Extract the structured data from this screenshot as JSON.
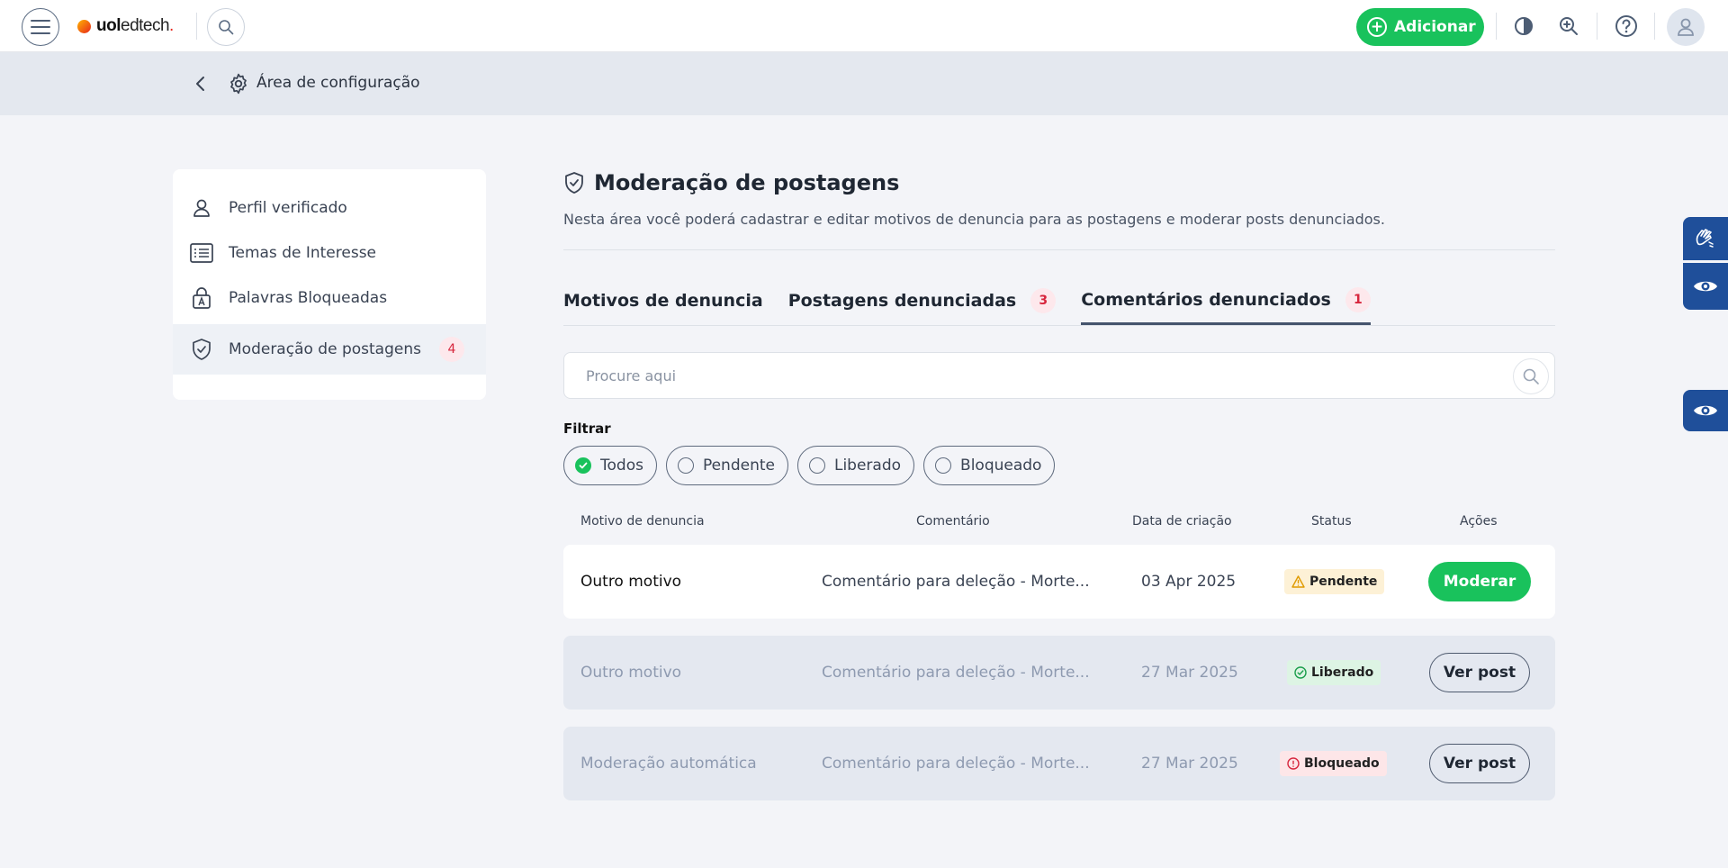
{
  "header": {
    "logo": {
      "bold": "uol",
      "thin": "edtech",
      "dot": "."
    },
    "add_label": "Adicionar",
    "icons": [
      "menu-icon",
      "search-icon",
      "contrast-icon",
      "zoom-in-icon",
      "help-icon",
      "user-icon"
    ]
  },
  "breadcrumb": {
    "label": "Área de configuração"
  },
  "sidebar": {
    "items": [
      {
        "label": "Perfil verificado",
        "icon": "user-icon"
      },
      {
        "label": "Temas de Interesse",
        "icon": "list-icon"
      },
      {
        "label": "Palavras Bloqueadas",
        "icon": "lock-icon"
      },
      {
        "label": "Moderação de postagens",
        "icon": "shield-check-icon",
        "count": "4"
      }
    ]
  },
  "main": {
    "title": "Moderação de postagens",
    "subtitle": "Nesta área você poderá cadastrar e editar motivos de denuncia para as postagens e moderar posts denunciados.",
    "tabs": [
      {
        "label": "Motivos de denuncia"
      },
      {
        "label": "Postagens denunciadas",
        "count": "3"
      },
      {
        "label": "Comentários denunciados",
        "count": "1"
      }
    ],
    "search_placeholder": "Procure aqui",
    "filter_label": "Filtrar",
    "filters": [
      "Todos",
      "Pendente",
      "Liberado",
      "Bloqueado"
    ],
    "table": {
      "headers": [
        "Motivo de denuncia",
        "Comentário",
        "Data de criação",
        "Status",
        "Ações"
      ],
      "rows": [
        {
          "motivo": "Outro motivo",
          "comentario": "Comentário para deleção - Morte...",
          "data": "03 Apr 2025",
          "status": "Pendente",
          "acao": "Moderar"
        },
        {
          "motivo": "Outro motivo",
          "comentario": "Comentário para deleção - Morte...",
          "data": "27 Mar 2025",
          "status": "Liberado",
          "acao": "Ver post"
        },
        {
          "motivo": "Moderação automática",
          "comentario": "Comentário para deleção - Morte...",
          "data": "27 Mar 2025",
          "status": "Bloqueado",
          "acao": "Ver post"
        }
      ]
    }
  },
  "colors": {
    "primary": "#19c25c",
    "accessibility": "#1f4f9a",
    "danger": "#d7263d"
  }
}
